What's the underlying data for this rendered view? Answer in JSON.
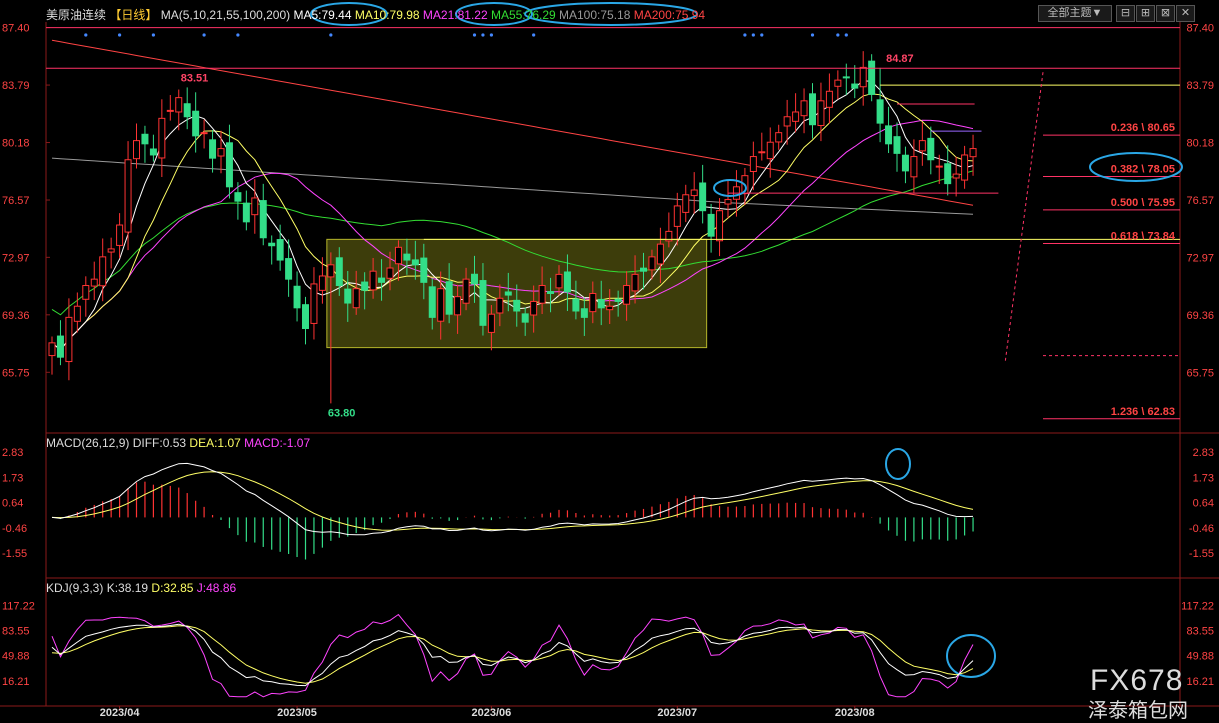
{
  "header": {
    "symbol": "美原油连续",
    "period": "【日线】",
    "ma_params": "MA(5,10,21,55,100,200)",
    "ma_values": [
      {
        "label": "MA5:79.44",
        "color": "#ffffff"
      },
      {
        "label": "MA10:79.98",
        "color": "#ffff66"
      },
      {
        "label": "MA21:81.22",
        "color": "#ff44ff"
      },
      {
        "label": "MA55:76.29",
        "color": "#33dd33"
      },
      {
        "label": "MA100:75.18",
        "color": "#999999"
      },
      {
        "label": "MA200:75.94",
        "color": "#ff4444"
      }
    ],
    "theme_button": "全部主题▼",
    "tool_buttons": [
      "⊟",
      "⊞",
      "⊠",
      "✕"
    ]
  },
  "main_axis": {
    "ticks": [
      87.4,
      83.79,
      80.18,
      76.57,
      72.97,
      69.36,
      65.75
    ],
    "tick_labels": [
      "87.40",
      "83.79",
      "80.18",
      "76.57",
      "72.97",
      "69.36",
      "65.75"
    ],
    "ylim": [
      62.0,
      87.5
    ]
  },
  "annotations": {
    "high_label": "84.87",
    "low_label": "63.80",
    "peak_label": "83.51",
    "fib_levels": [
      {
        "label": "0.236 \\ 80.65",
        "value": 80.65
      },
      {
        "label": "0.382 \\ 78.05",
        "value": 78.05
      },
      {
        "label": "0.500 \\ 75.95",
        "value": 75.95
      },
      {
        "label": "0.618 \\ 73.84",
        "value": 73.84
      },
      {
        "label": "1.236 \\ 62.83",
        "value": 62.83
      }
    ]
  },
  "macd": {
    "title": "MACD(26,12,9)",
    "diff": "DIFF:0.53",
    "dea": "DEA:1.07",
    "macd": "MACD:-1.07",
    "tick_labels": [
      "2.83",
      "1.73",
      "0.64",
      "-0.46",
      "-1.55"
    ],
    "ticks": [
      2.83,
      1.73,
      0.64,
      -0.46,
      -1.55
    ],
    "ylim": [
      -2.5,
      3.1
    ]
  },
  "kdj": {
    "title": "KDJ(9,3,3)",
    "k": "K:38.19",
    "d": "D:32.85",
    "j": "J:48.86",
    "tick_labels": [
      "117.22",
      "83.55",
      "49.88",
      "16.21"
    ],
    "ticks": [
      117.22,
      83.55,
      49.88,
      16.21
    ],
    "ylim": [
      -12,
      135
    ]
  },
  "x_axis": {
    "labels": [
      {
        "text": "2023/04",
        "index": 8
      },
      {
        "text": "2023/05",
        "index": 29
      },
      {
        "text": "2023/06",
        "index": 52
      },
      {
        "text": "2023/07",
        "index": 74
      },
      {
        "text": "2023/08",
        "index": 95
      }
    ]
  },
  "watermark": {
    "top": "FX678",
    "bottom": "泽泰箱包网"
  },
  "colors": {
    "up": "#ff3333",
    "down": "#33dd88",
    "ma5": "#ffffff",
    "ma10": "#ffff66",
    "ma21": "#ff44ff",
    "ma55": "#33dd33",
    "ma100": "#999999",
    "ma200": "#ff4444",
    "highlight": "#2aa7e6",
    "axis_text": "#ff4444"
  },
  "chart_data": {
    "type": "candlestick",
    "closes": [
      67.6,
      66.7,
      69.2,
      69.9,
      71.2,
      71.6,
      73.0,
      73.5,
      75.0,
      79.1,
      80.3,
      80.1,
      79.4,
      81.7,
      82.2,
      83.0,
      81.8,
      80.6,
      80.8,
      79.2,
      79.8,
      77.4,
      76.5,
      75.2,
      76.7,
      74.2,
      73.7,
      72.8,
      71.6,
      69.8,
      68.5,
      71.3,
      71.8,
      72.5,
      71.2,
      70.1,
      71.0,
      70.9,
      72.1,
      71.4,
      72.3,
      73.6,
      72.8,
      72.5,
      71.4,
      69.2,
      71.0,
      69.4,
      70.5,
      71.6,
      71.3,
      68.7,
      69.4,
      70.4,
      70.6,
      69.6,
      68.9,
      70.2,
      71.2,
      70.7,
      71.9,
      70.8,
      69.6,
      69.2,
      70.7,
      69.8,
      69.9,
      70.2,
      71.2,
      71.9,
      72.1,
      73.0,
      73.8,
      74.6,
      76.2,
      76.9,
      77.2,
      75.9,
      74.3,
      75.9,
      76.6,
      77.4,
      78.1,
      79.3,
      79.6,
      80.2,
      80.8,
      81.8,
      82.1,
      82.8,
      81.3,
      82.8,
      83.4,
      84.1,
      84.3,
      83.6,
      84.9,
      83.2,
      81.4,
      80.1,
      79.5,
      78.4,
      79.3,
      80.3,
      79.1,
      78.7,
      77.6,
      78.2,
      79.4,
      79.8
    ]
  }
}
